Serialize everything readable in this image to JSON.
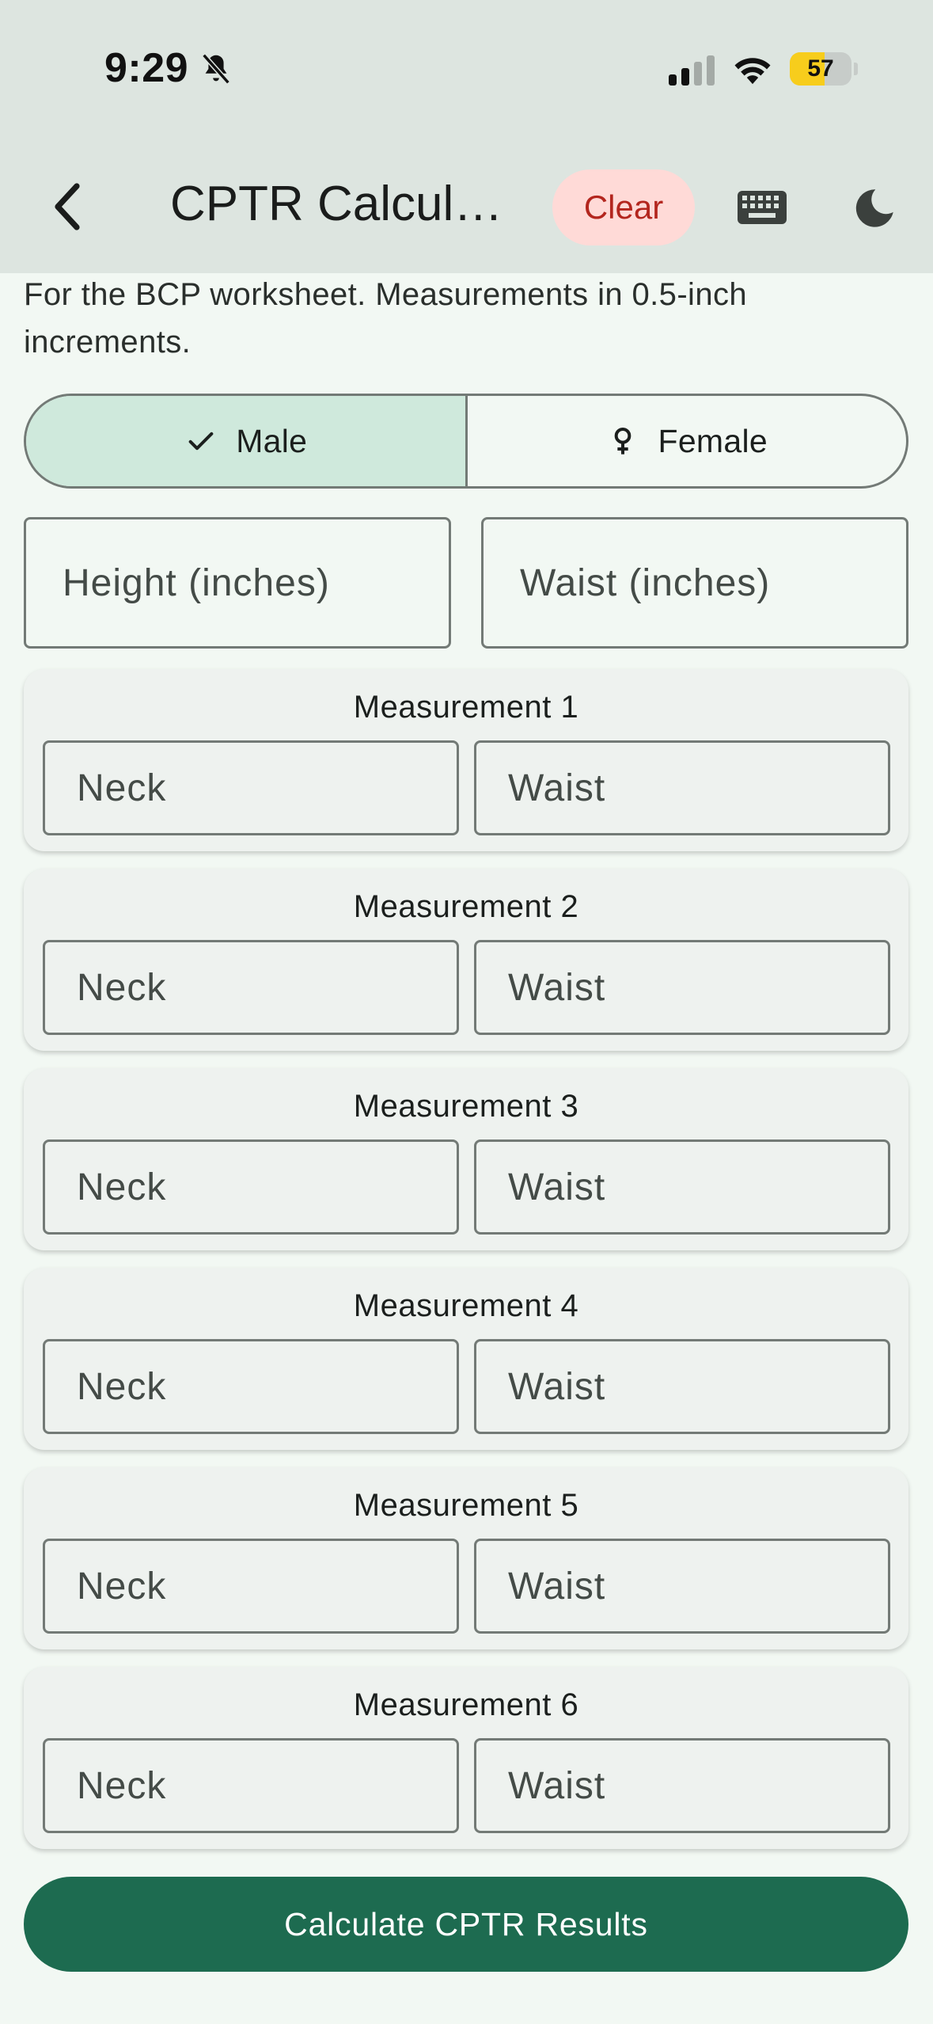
{
  "status_bar": {
    "time": "9:29",
    "battery_percent": "57",
    "battery_level": 0.57
  },
  "app_bar": {
    "title": "CPTR Calcula...",
    "clear_label": "Clear"
  },
  "description": "For the BCP worksheet. Measurements in 0.5-inch increments.",
  "gender_toggle": {
    "selected": "Male",
    "options": [
      {
        "label": "Male",
        "icon": "check-icon"
      },
      {
        "label": "Female",
        "icon": "female-icon"
      }
    ]
  },
  "inputs": {
    "height": {
      "placeholder": "Height (inches)",
      "value": ""
    },
    "waist": {
      "placeholder": "Waist (inches)",
      "value": ""
    }
  },
  "measurements": [
    {
      "title": "Measurement 1",
      "neck_placeholder": "Neck",
      "waist_placeholder": "Waist"
    },
    {
      "title": "Measurement 2",
      "neck_placeholder": "Neck",
      "waist_placeholder": "Waist"
    },
    {
      "title": "Measurement 3",
      "neck_placeholder": "Neck",
      "waist_placeholder": "Waist"
    },
    {
      "title": "Measurement 4",
      "neck_placeholder": "Neck",
      "waist_placeholder": "Waist"
    },
    {
      "title": "Measurement 5",
      "neck_placeholder": "Neck",
      "waist_placeholder": "Waist"
    },
    {
      "title": "Measurement 6",
      "neck_placeholder": "Neck",
      "waist_placeholder": "Waist"
    }
  ],
  "calculate_label": "Calculate CPTR Results",
  "colors": {
    "primary": "#1d6b50",
    "selected_segment": "#cfe9dc",
    "clear_bg": "#ffdad7",
    "clear_text": "#b3261e",
    "background": "#f2f8f3",
    "header": "#dde5e0",
    "battery": "#f7cd1c"
  }
}
